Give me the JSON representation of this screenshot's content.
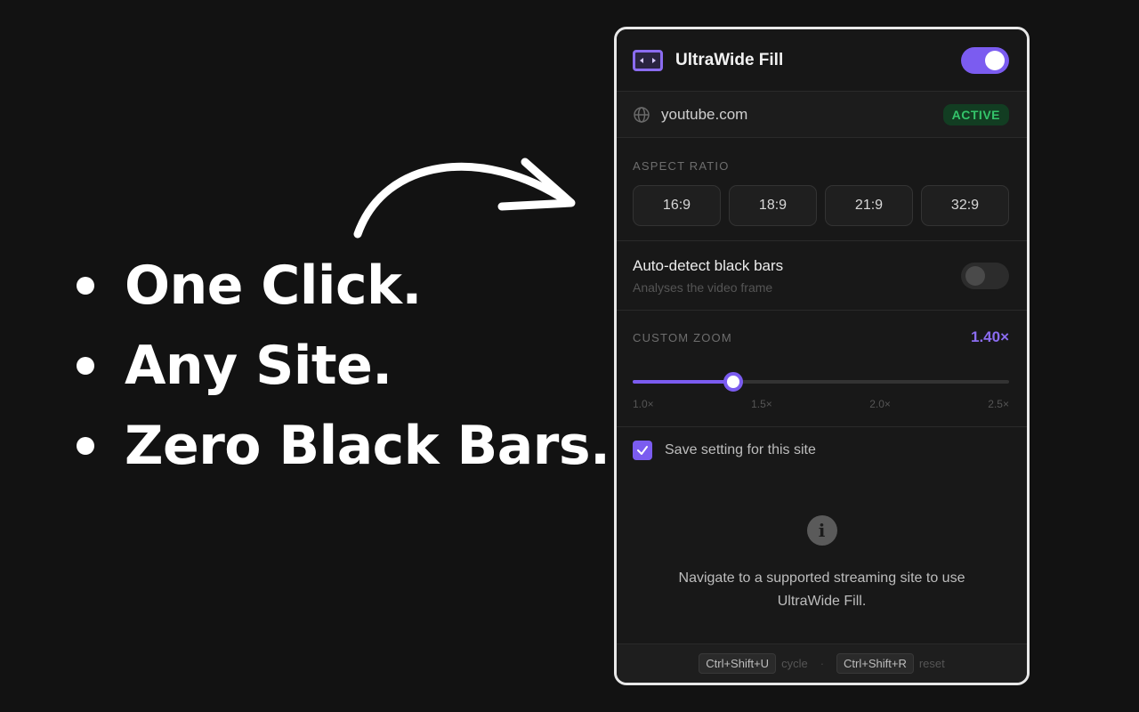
{
  "marketing": {
    "bullets": [
      "One Click.",
      "Any Site.",
      "Zero Black Bars."
    ]
  },
  "popup": {
    "title": "UltraWide Fill",
    "logo_icon": "ultrawide-screen-icon",
    "enabled": true,
    "site": {
      "icon": "globe-icon",
      "name": "youtube.com",
      "status": "ACTIVE"
    },
    "aspect_ratio": {
      "label": "ASPECT RATIO",
      "options": [
        "16:9",
        "18:9",
        "21:9",
        "32:9"
      ]
    },
    "auto_detect": {
      "title": "Auto-detect black bars",
      "subtitle": "Analyses the video frame",
      "enabled": false
    },
    "zoom": {
      "label": "CUSTOM ZOOM",
      "value_label": "1.40×",
      "value": 1.4,
      "min": 1.0,
      "max": 2.5,
      "ticks": [
        "1.0×",
        "1.5×",
        "2.0×",
        "2.5×"
      ]
    },
    "save_setting": {
      "label": "Save setting for this site",
      "checked": true
    },
    "info": {
      "icon": "info-icon",
      "message": "Navigate to a supported streaming site to use UltraWide Fill."
    },
    "footer": {
      "shortcut1": "Ctrl+Shift+U",
      "action1": "cycle",
      "separator": "·",
      "shortcut2": "Ctrl+Shift+R",
      "action2": "reset"
    }
  },
  "colors": {
    "accent": "#7b5cf0",
    "active_green": "#34c46a",
    "background": "#121212"
  }
}
